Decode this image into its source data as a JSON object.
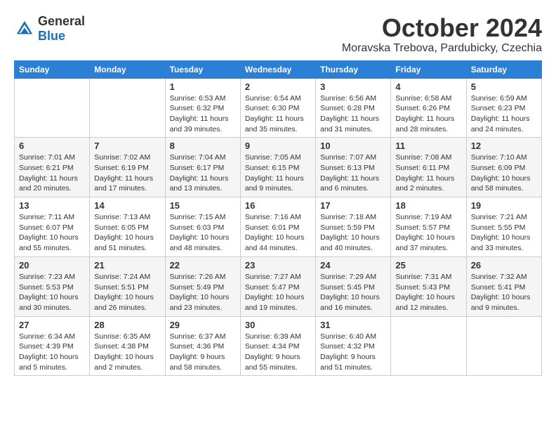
{
  "header": {
    "logo_general": "General",
    "logo_blue": "Blue",
    "month": "October 2024",
    "location": "Moravska Trebova, Pardubicky, Czechia"
  },
  "weekdays": [
    "Sunday",
    "Monday",
    "Tuesday",
    "Wednesday",
    "Thursday",
    "Friday",
    "Saturday"
  ],
  "weeks": [
    [
      {
        "day": "",
        "info": ""
      },
      {
        "day": "",
        "info": ""
      },
      {
        "day": "1",
        "info": "Sunrise: 6:53 AM\nSunset: 6:32 PM\nDaylight: 11 hours and 39 minutes."
      },
      {
        "day": "2",
        "info": "Sunrise: 6:54 AM\nSunset: 6:30 PM\nDaylight: 11 hours and 35 minutes."
      },
      {
        "day": "3",
        "info": "Sunrise: 6:56 AM\nSunset: 6:28 PM\nDaylight: 11 hours and 31 minutes."
      },
      {
        "day": "4",
        "info": "Sunrise: 6:58 AM\nSunset: 6:26 PM\nDaylight: 11 hours and 28 minutes."
      },
      {
        "day": "5",
        "info": "Sunrise: 6:59 AM\nSunset: 6:23 PM\nDaylight: 11 hours and 24 minutes."
      }
    ],
    [
      {
        "day": "6",
        "info": "Sunrise: 7:01 AM\nSunset: 6:21 PM\nDaylight: 11 hours and 20 minutes."
      },
      {
        "day": "7",
        "info": "Sunrise: 7:02 AM\nSunset: 6:19 PM\nDaylight: 11 hours and 17 minutes."
      },
      {
        "day": "8",
        "info": "Sunrise: 7:04 AM\nSunset: 6:17 PM\nDaylight: 11 hours and 13 minutes."
      },
      {
        "day": "9",
        "info": "Sunrise: 7:05 AM\nSunset: 6:15 PM\nDaylight: 11 hours and 9 minutes."
      },
      {
        "day": "10",
        "info": "Sunrise: 7:07 AM\nSunset: 6:13 PM\nDaylight: 11 hours and 6 minutes."
      },
      {
        "day": "11",
        "info": "Sunrise: 7:08 AM\nSunset: 6:11 PM\nDaylight: 11 hours and 2 minutes."
      },
      {
        "day": "12",
        "info": "Sunrise: 7:10 AM\nSunset: 6:09 PM\nDaylight: 10 hours and 58 minutes."
      }
    ],
    [
      {
        "day": "13",
        "info": "Sunrise: 7:11 AM\nSunset: 6:07 PM\nDaylight: 10 hours and 55 minutes."
      },
      {
        "day": "14",
        "info": "Sunrise: 7:13 AM\nSunset: 6:05 PM\nDaylight: 10 hours and 51 minutes."
      },
      {
        "day": "15",
        "info": "Sunrise: 7:15 AM\nSunset: 6:03 PM\nDaylight: 10 hours and 48 minutes."
      },
      {
        "day": "16",
        "info": "Sunrise: 7:16 AM\nSunset: 6:01 PM\nDaylight: 10 hours and 44 minutes."
      },
      {
        "day": "17",
        "info": "Sunrise: 7:18 AM\nSunset: 5:59 PM\nDaylight: 10 hours and 40 minutes."
      },
      {
        "day": "18",
        "info": "Sunrise: 7:19 AM\nSunset: 5:57 PM\nDaylight: 10 hours and 37 minutes."
      },
      {
        "day": "19",
        "info": "Sunrise: 7:21 AM\nSunset: 5:55 PM\nDaylight: 10 hours and 33 minutes."
      }
    ],
    [
      {
        "day": "20",
        "info": "Sunrise: 7:23 AM\nSunset: 5:53 PM\nDaylight: 10 hours and 30 minutes."
      },
      {
        "day": "21",
        "info": "Sunrise: 7:24 AM\nSunset: 5:51 PM\nDaylight: 10 hours and 26 minutes."
      },
      {
        "day": "22",
        "info": "Sunrise: 7:26 AM\nSunset: 5:49 PM\nDaylight: 10 hours and 23 minutes."
      },
      {
        "day": "23",
        "info": "Sunrise: 7:27 AM\nSunset: 5:47 PM\nDaylight: 10 hours and 19 minutes."
      },
      {
        "day": "24",
        "info": "Sunrise: 7:29 AM\nSunset: 5:45 PM\nDaylight: 10 hours and 16 minutes."
      },
      {
        "day": "25",
        "info": "Sunrise: 7:31 AM\nSunset: 5:43 PM\nDaylight: 10 hours and 12 minutes."
      },
      {
        "day": "26",
        "info": "Sunrise: 7:32 AM\nSunset: 5:41 PM\nDaylight: 10 hours and 9 minutes."
      }
    ],
    [
      {
        "day": "27",
        "info": "Sunrise: 6:34 AM\nSunset: 4:39 PM\nDaylight: 10 hours and 5 minutes."
      },
      {
        "day": "28",
        "info": "Sunrise: 6:35 AM\nSunset: 4:38 PM\nDaylight: 10 hours and 2 minutes."
      },
      {
        "day": "29",
        "info": "Sunrise: 6:37 AM\nSunset: 4:36 PM\nDaylight: 9 hours and 58 minutes."
      },
      {
        "day": "30",
        "info": "Sunrise: 6:39 AM\nSunset: 4:34 PM\nDaylight: 9 hours and 55 minutes."
      },
      {
        "day": "31",
        "info": "Sunrise: 6:40 AM\nSunset: 4:32 PM\nDaylight: 9 hours and 51 minutes."
      },
      {
        "day": "",
        "info": ""
      },
      {
        "day": "",
        "info": ""
      }
    ]
  ]
}
